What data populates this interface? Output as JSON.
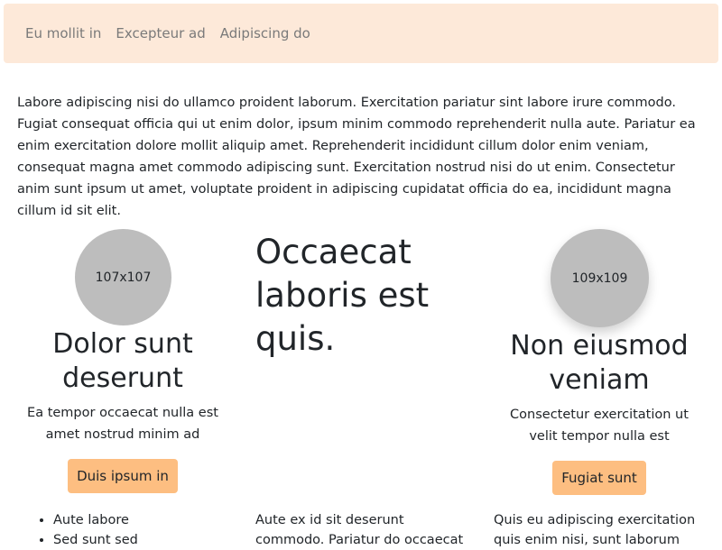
{
  "nav": {
    "links": [
      "Eu mollit in",
      "Excepteur ad",
      "Adipiscing do"
    ]
  },
  "intro": {
    "text": "Labore adipiscing nisi do ullamco proident laborum. Exercitation pariatur sint labore irure commodo. Fugiat consequat officia qui ut enim dolor, ipsum minim commodo reprehenderit nulla aute. Pariatur ea enim exercitation dolore mollit aliquip amet. Reprehenderit incididunt cillum dolor enim veniam, consequat magna amet commodo adipiscing sunt. Exercitation nostrud nisi do ut enim. Consectetur anim sunt ipsum ut amet, voluptate proident in adipiscing cupidatat officia do ea, incididunt magna cillum id sit elit."
  },
  "card_left": {
    "avatar_label": "107x107",
    "title": "Dolor sunt deserunt",
    "text": "Ea tempor occaecat nulla est amet nostrud minim ad",
    "button": "Duis ipsum in"
  },
  "center": {
    "heading": "Occaecat laboris est quis."
  },
  "card_right": {
    "avatar_label": "109x109",
    "title": "Non eiusmod veniam",
    "text": "Consectetur exercitation ut velit tempor nulla est",
    "button": "Fugiat sunt"
  },
  "bottom": {
    "list": [
      "Aute labore",
      "Sed sunt sed"
    ],
    "mid_text": "Aute ex id sit deserunt commodo. Pariatur do occaecat",
    "right_text": "Quis eu adipiscing exercitation quis enim nisi, sunt laborum"
  },
  "colors": {
    "navbar_bg": "#fde9d9",
    "button_bg": "#fdbe81",
    "avatar_bg": "#bdbdbd"
  }
}
